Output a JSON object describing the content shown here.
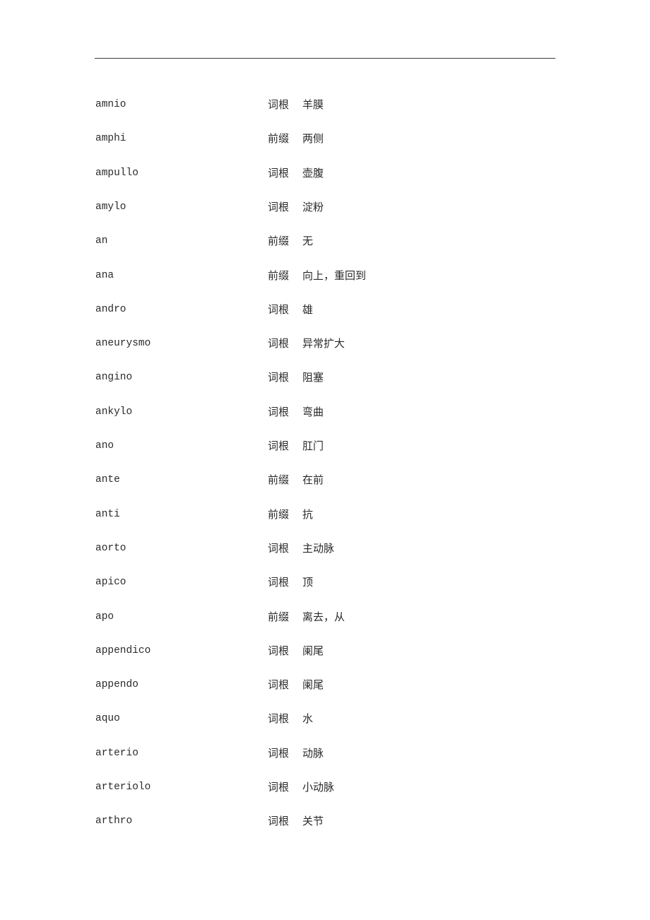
{
  "document": {
    "entries": [
      {
        "term": "amnio",
        "kind": "词根",
        "meaning": "羊膜"
      },
      {
        "term": "amphi",
        "kind": "前缀",
        "meaning": "两侧"
      },
      {
        "term": "ampullo",
        "kind": "词根",
        "meaning": "壶腹"
      },
      {
        "term": "amylo",
        "kind": "词根",
        "meaning": "淀粉"
      },
      {
        "term": "an",
        "kind": "前缀",
        "meaning": "无"
      },
      {
        "term": "ana",
        "kind": "前缀",
        "meaning": "向上，重回到"
      },
      {
        "term": "andro",
        "kind": "词根",
        "meaning": "雄"
      },
      {
        "term": "aneurysmo",
        "kind": "词根",
        "meaning": "异常扩大"
      },
      {
        "term": "angino",
        "kind": "词根",
        "meaning": "阻塞"
      },
      {
        "term": "ankylo",
        "kind": "词根",
        "meaning": "弯曲"
      },
      {
        "term": "ano",
        "kind": "词根",
        "meaning": "肛门"
      },
      {
        "term": "ante",
        "kind": "前缀",
        "meaning": "在前"
      },
      {
        "term": "anti",
        "kind": "前缀",
        "meaning": "抗"
      },
      {
        "term": "aorto",
        "kind": "词根",
        "meaning": "主动脉"
      },
      {
        "term": "apico",
        "kind": "词根",
        "meaning": "顶"
      },
      {
        "term": "apo",
        "kind": "前缀",
        "meaning": "离去，从"
      },
      {
        "term": "appendico",
        "kind": "词根",
        "meaning": "阑尾"
      },
      {
        "term": "appendo",
        "kind": "词根",
        "meaning": "阑尾"
      },
      {
        "term": "aquo",
        "kind": "词根",
        "meaning": "水"
      },
      {
        "term": "arterio",
        "kind": "词根",
        "meaning": "动脉"
      },
      {
        "term": "arteriolo",
        "kind": "词根",
        "meaning": "小动脉"
      },
      {
        "term": "arthro",
        "kind": "词根",
        "meaning": "关节"
      }
    ]
  }
}
